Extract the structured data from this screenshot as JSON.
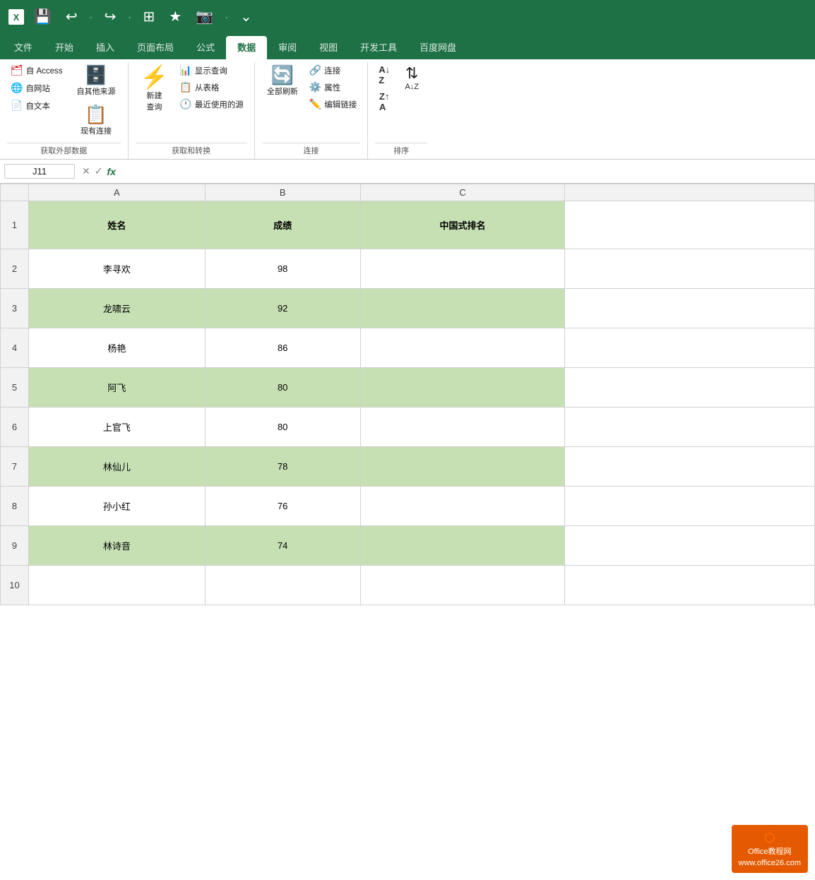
{
  "titlebar": {
    "save_icon": "💾",
    "undo_icon": "↩",
    "redo_icon": "↪",
    "table_icon": "⊞",
    "star_icon": "★",
    "camera_icon": "📷"
  },
  "ribbon": {
    "tabs": [
      {
        "label": "文件",
        "active": false
      },
      {
        "label": "开始",
        "active": false
      },
      {
        "label": "插入",
        "active": false
      },
      {
        "label": "页面布局",
        "active": false
      },
      {
        "label": "公式",
        "active": false
      },
      {
        "label": "数据",
        "active": true
      },
      {
        "label": "审阅",
        "active": false
      },
      {
        "label": "视图",
        "active": false
      },
      {
        "label": "开发工具",
        "active": false
      },
      {
        "label": "百度网盘",
        "active": false
      }
    ],
    "groups": {
      "external_data": {
        "label": "获取外部数据",
        "access_label": "自 Access",
        "web_label": "自网站",
        "text_label": "自文本",
        "other_label": "自其他来源",
        "existing_label": "现有连接"
      },
      "get_transform": {
        "label": "获取和转换",
        "new_query_label": "新建\n查询",
        "show_query_label": "显示查询",
        "from_table_label": "从表格",
        "recent_source_label": "最近使用的源"
      },
      "connections": {
        "label": "连接",
        "refresh_label": "全部刷新",
        "connections_label": "连接",
        "properties_label": "属性",
        "edit_links_label": "编辑链接"
      },
      "sort": {
        "label": "排序",
        "az_label": "A↓Z",
        "za_label": "Z↑A"
      }
    }
  },
  "formula_bar": {
    "name_box": "J11",
    "cancel": "✕",
    "confirm": "✓",
    "fx": "fx"
  },
  "columns": {
    "corner": "",
    "headers": [
      "A",
      "B",
      "C"
    ],
    "widths": [
      250,
      220,
      290
    ]
  },
  "rows": [
    {
      "num": 1,
      "cells": [
        "姓名",
        "成绩",
        "中国式排名"
      ],
      "bg": [
        "green-alt",
        "green-alt",
        "green-alt"
      ],
      "header": true
    },
    {
      "num": 2,
      "cells": [
        "李寻欢",
        "98",
        ""
      ],
      "bg": [
        "white",
        "white",
        "white"
      ]
    },
    {
      "num": 3,
      "cells": [
        "龙啸云",
        "92",
        ""
      ],
      "bg": [
        "green-alt",
        "green-alt",
        "green-alt"
      ]
    },
    {
      "num": 4,
      "cells": [
        "杨艳",
        "86",
        ""
      ],
      "bg": [
        "white",
        "white",
        "white"
      ]
    },
    {
      "num": 5,
      "cells": [
        "阿飞",
        "80",
        ""
      ],
      "bg": [
        "green-alt",
        "green-alt",
        "green-alt"
      ]
    },
    {
      "num": 6,
      "cells": [
        "上官飞",
        "80",
        ""
      ],
      "bg": [
        "white",
        "white",
        "white"
      ]
    },
    {
      "num": 7,
      "cells": [
        "林仙儿",
        "78",
        ""
      ],
      "bg": [
        "green-alt",
        "green-alt",
        "green-alt"
      ]
    },
    {
      "num": 8,
      "cells": [
        "孙小红",
        "76",
        ""
      ],
      "bg": [
        "white",
        "white",
        "white"
      ]
    },
    {
      "num": 9,
      "cells": [
        "林诗音",
        "74",
        ""
      ],
      "bg": [
        "green-alt",
        "green-alt",
        "green-alt"
      ]
    }
  ],
  "logo": {
    "line1": "Office教程网",
    "line2": "www.office26.com"
  }
}
